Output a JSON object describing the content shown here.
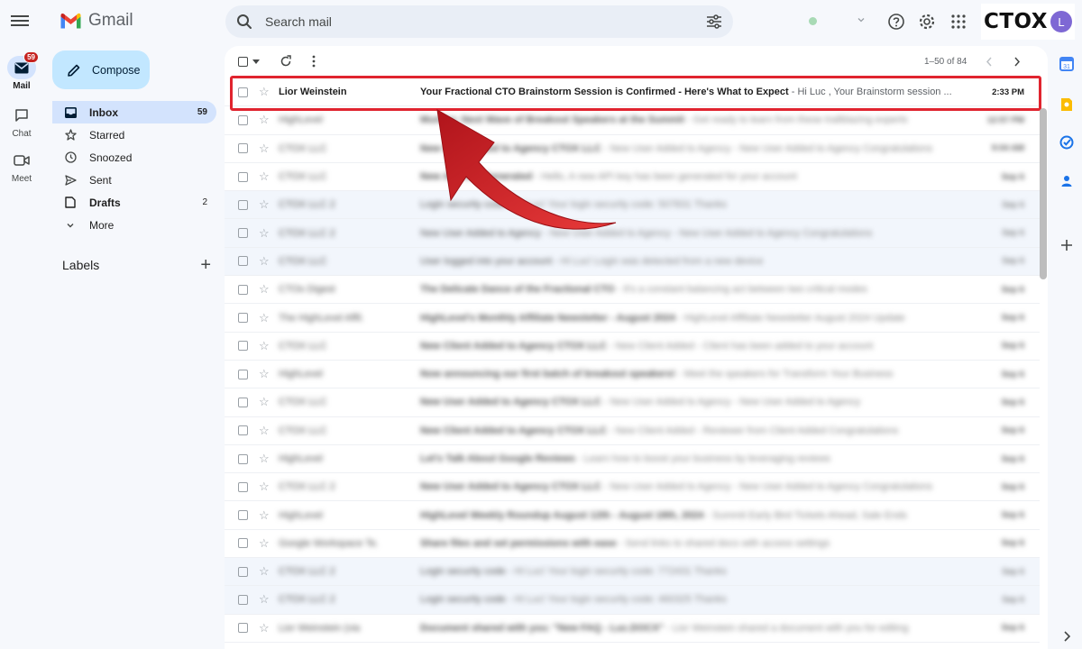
{
  "app": {
    "name": "Gmail"
  },
  "rail": {
    "items": [
      {
        "label": "Mail",
        "badge": "59",
        "icon": "mail-icon",
        "active": true
      },
      {
        "label": "Chat",
        "icon": "chat-icon"
      },
      {
        "label": "Meet",
        "icon": "video-icon"
      }
    ]
  },
  "search": {
    "placeholder": "Search mail"
  },
  "brand": {
    "text": "CTOX",
    "avatar_letter": "L"
  },
  "compose": {
    "label": "Compose"
  },
  "nav": {
    "items": [
      {
        "label": "Inbox",
        "count": "59",
        "icon": "inbox-icon"
      },
      {
        "label": "Starred",
        "count": "",
        "icon": "star-icon"
      },
      {
        "label": "Snoozed",
        "count": "",
        "icon": "clock-icon"
      },
      {
        "label": "Sent",
        "count": "",
        "icon": "send-icon"
      },
      {
        "label": "Drafts",
        "count": "2",
        "icon": "draft-icon"
      },
      {
        "label": "More",
        "count": "",
        "icon": "chevron-down-icon"
      }
    ],
    "labels_heading": "Labels"
  },
  "toolbar": {
    "pager": "1–50 of 84"
  },
  "emails": {
    "highlighted": {
      "sender": "Lior Weinstein",
      "subject": "Your Fractional CTO Brainstorm Session is Confirmed - Here's What to Expect",
      "snippet": " - Hi Luc , Your Brainstorm session ...",
      "time": "2:33 PM"
    },
    "rows": [
      {
        "sender": "HighLevel",
        "subject": "Mumbo: Next Wave of Breakout Speakers at the Summit",
        "snippet": " - Get ready to learn from these trailblazing experts",
        "time": "12:57 PM",
        "read": false
      },
      {
        "sender": "CTOX LLC",
        "subject": "New User Added to Agency CTOX LLC",
        "snippet": " - New User Added to Agency - New User Added to Agency Congratulations",
        "time": "9:04 AM",
        "read": false
      },
      {
        "sender": "CTOX LLC",
        "subject": "New API Key Generated",
        "snippet": " - Hello, A new API key has been generated for your account",
        "time": "Sep 6",
        "read": false
      },
      {
        "sender": "CTOX LLC 2",
        "subject": "Login security code",
        "snippet": " - Hi Luc! Your login security code: 507831 Thanks",
        "time": "Sep 6",
        "read": true
      },
      {
        "sender": "CTOX LLC 2",
        "subject": "New User Added to Agency",
        "snippet": " - New User Added to Agency - New User Added to Agency Congratulations",
        "time": "Sep 6",
        "read": true
      },
      {
        "sender": "CTOX LLC",
        "subject": "User logged into your account",
        "snippet": " - Hi Luc! Login was detected from a new device",
        "time": "Sep 6",
        "read": true
      },
      {
        "sender": "CTOs Digest",
        "subject": "The Delicate Dance of the Fractional CTO",
        "snippet": " - It's a constant balancing act between two critical modes",
        "time": "Sep 6",
        "read": false
      },
      {
        "sender": "The HighLevel Affil.",
        "subject": "HighLevel's Monthly Affiliate Newsletter - August 2024",
        "snippet": " - HighLevel Affiliate Newsletter August 2024 Update",
        "time": "Sep 6",
        "read": false
      },
      {
        "sender": "CTOX LLC",
        "subject": "New Client Added to Agency CTOX LLC",
        "snippet": " - New Client Added - Client has been added to your account",
        "time": "Sep 6",
        "read": false
      },
      {
        "sender": "HighLevel",
        "subject": "Now announcing our first batch of breakout speakers!",
        "snippet": " - Meet the speakers for Transform Your Business",
        "time": "Sep 6",
        "read": false
      },
      {
        "sender": "CTOX LLC",
        "subject": "New User Added to Agency CTOX LLC",
        "snippet": " - New User Added to Agency - New User Added to Agency",
        "time": "Sep 6",
        "read": false
      },
      {
        "sender": "CTOX LLC",
        "subject": "New Client Added to Agency CTOX LLC",
        "snippet": " - New Client Added - Reviewer from Client Added Congratulations",
        "time": "Sep 6",
        "read": false
      },
      {
        "sender": "HighLevel",
        "subject": "Let's Talk About Google Reviews",
        "snippet": " - Learn how to boost your business by leveraging reviews",
        "time": "Sep 6",
        "read": false
      },
      {
        "sender": "CTOX LLC 2",
        "subject": "New User Added to Agency CTOX LLC",
        "snippet": " - New User Added to Agency - New User Added to Agency Congratulations",
        "time": "Sep 6",
        "read": false
      },
      {
        "sender": "HighLevel",
        "subject": "HighLevel Weekly Roundup August 12th - August 18th, 2024",
        "snippet": " - Summit Early Bird Tickets Ahead, Sale Ends",
        "time": "Sep 6",
        "read": false
      },
      {
        "sender": "Google Workspace Te.",
        "subject": "Share files and set permissions with ease",
        "snippet": " - Send links to shared docs with access settings",
        "time": "Sep 6",
        "read": false
      },
      {
        "sender": "CTOX LLC 2",
        "subject": "Login security code",
        "snippet": " - Hi Luc! Your login security code: 772431 Thanks",
        "time": "Sep 6",
        "read": true
      },
      {
        "sender": "CTOX LLC 2",
        "subject": "Login security code",
        "snippet": " - Hi Luc! Your login security code: 460325 Thanks",
        "time": "Sep 6",
        "read": true
      },
      {
        "sender": "Lior Weinstein (via",
        "subject": "Document shared with you: \"New FAQ - Luc.DOCX\"",
        "snippet": " - Lior Weinstein shared a document with you for editing",
        "time": "Sep 6",
        "read": false
      }
    ]
  },
  "colors": {
    "highlight": "#e0242f",
    "arrow": "#d61c23",
    "accent": "#0b57d0"
  }
}
